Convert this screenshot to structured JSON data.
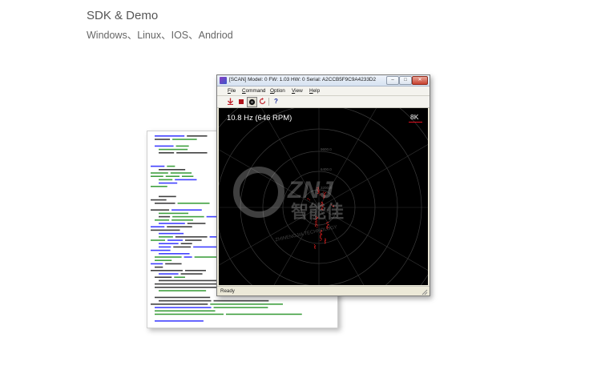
{
  "page": {
    "title": "SDK & Demo",
    "subtitle": "Windows、Linux、IOS、Andriod"
  },
  "window": {
    "title": "[SCAN] Model: 0 FW: 1.03 HW: 0 Serial: A2CCB5F9C9A4233D2",
    "menu": [
      {
        "label": "File",
        "hotkey": "F",
        "rest": "ile"
      },
      {
        "label": "Command",
        "hotkey": "C",
        "rest": "ommand"
      },
      {
        "label": "Option",
        "hotkey": "O",
        "rest": "ption"
      },
      {
        "label": "View",
        "hotkey": "V",
        "rest": "iew"
      },
      {
        "label": "Help",
        "hotkey": "H",
        "rest": "elp"
      }
    ],
    "toolbar": [
      "connect-icon",
      "stop-icon",
      "record-icon",
      "refresh-icon",
      "help-icon"
    ],
    "scan": {
      "rate_text": "10.8 Hz (646 RPM)",
      "sample_badge": "8K",
      "ring_labels": [
        "9600.0",
        "6400.0",
        "3200.0"
      ]
    },
    "status": "Ready"
  },
  "watermark": {
    "brand": "ZNJ",
    "name_cn": "智能佳",
    "name_en": "ZHINENGJIA TECHNOLOGY"
  },
  "colors": {
    "accent_red": "#e01020",
    "scan_background": "#000000",
    "code_keyword": "#0000ff",
    "code_comment": "#008000",
    "code_text": "#000000"
  }
}
